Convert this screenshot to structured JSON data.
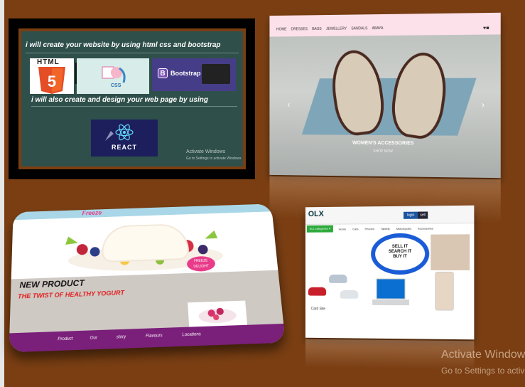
{
  "panel_html": {
    "line1": "i will create your website by using html css and bootstrap",
    "line2": "i will also create and design your web page by using",
    "html5_label": "HTML",
    "html5_number": "5",
    "css_label": "CSS",
    "bootstrap_letter": "B",
    "bootstrap_label": "Bootstrap",
    "react_label": "REACT",
    "watermark_title": "Activate Windows",
    "watermark_sub": "Go to Settings to activate Windows"
  },
  "panel_shop": {
    "nav": [
      "HOME",
      "DRESSES",
      "BAGS",
      "JEWELLERY",
      "SANDALS",
      "ABAYA"
    ],
    "cart_icon": "♥■",
    "caption_title": "WOMEN'S ACCESSORIES",
    "caption_sub": "SHOP NOW",
    "prev": "‹",
    "next": "›"
  },
  "panel_yogurt": {
    "brand": "Freeze",
    "badge": "FREEZE DELIGHT",
    "headline": "NEW PRODUCT",
    "tagline": "THE TWIST OF HEALTHY YOGURT",
    "footer_links": [
      "Product",
      "Our",
      "story",
      "Flavours",
      "Locations"
    ]
  },
  "panel_olx": {
    "logo": "OLX",
    "login": "login",
    "sell": "sell",
    "categories_button": "ALL categories ▾",
    "categories": [
      "Home",
      "Cars",
      "Phones",
      "Tablets",
      "Motorcycles",
      "Accessories"
    ],
    "sell_lines": [
      "SELL IT",
      "SEARCH IT",
      "BUY IT"
    ],
    "car_label": "Card Site"
  },
  "watermark": {
    "title": "Activate Windows",
    "sub": "Go to Settings to activate"
  }
}
